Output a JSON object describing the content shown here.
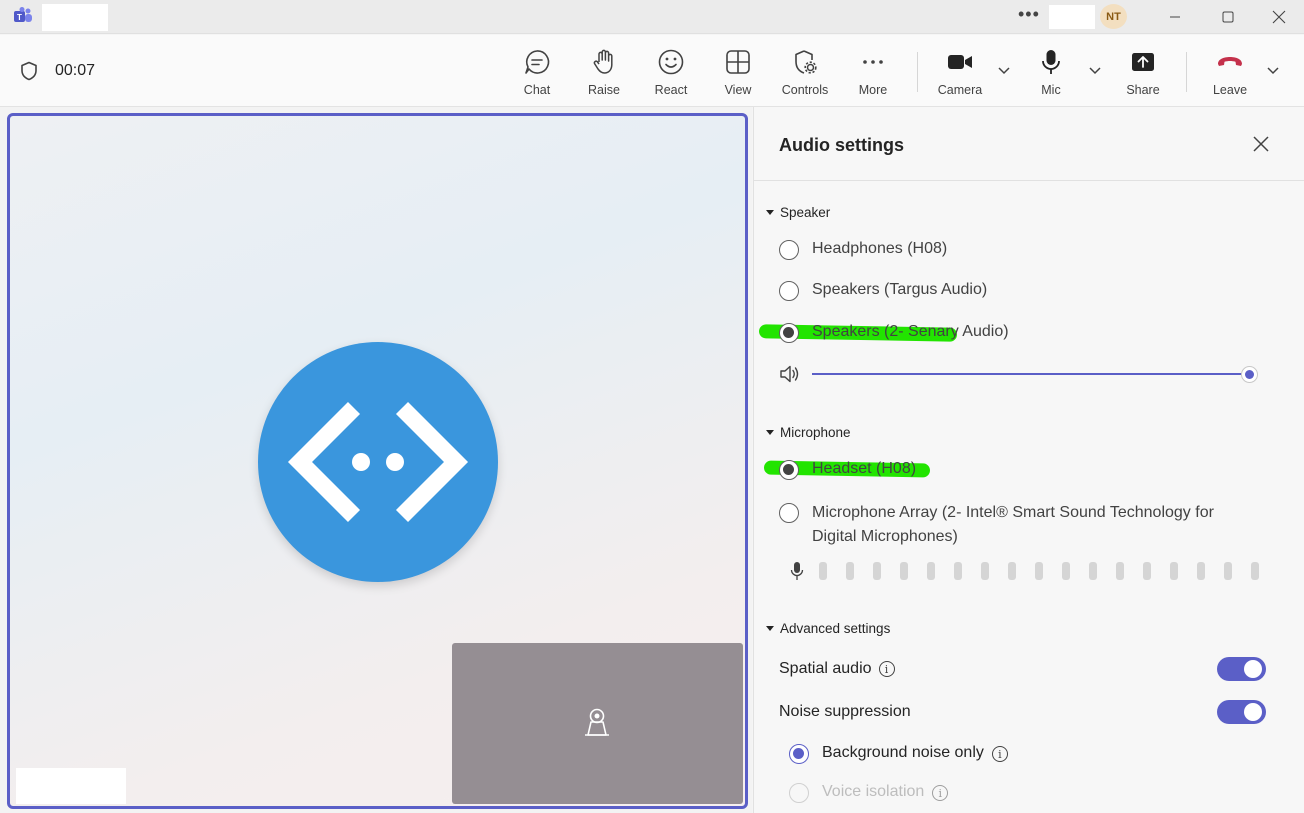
{
  "header": {
    "avatar_initials": "NT",
    "more_options": "•••"
  },
  "toolbar": {
    "timer": "00:07",
    "buttons": {
      "chat": "Chat",
      "raise": "Raise",
      "react": "React",
      "view": "View",
      "controls": "Controls",
      "more": "More",
      "camera": "Camera",
      "mic": "Mic",
      "share": "Share",
      "leave": "Leave"
    },
    "leave_color": "#c4314b"
  },
  "panel": {
    "title": "Audio settings",
    "speaker": {
      "heading": "Speaker",
      "options": [
        "Headphones (H08)",
        "Speakers (Targus Audio)",
        "Speakers (2- Senary Audio)"
      ],
      "selected": "Speakers (2- Senary Audio)",
      "volume": 1.0
    },
    "microphone": {
      "heading": "Microphone",
      "options": [
        "Headset (H08)",
        "Microphone Array (2- Intel® Smart Sound Technology for Digital Microphones)"
      ],
      "option2_line1": "Microphone Array (2- Intel® Smart Sound Technology for",
      "option2_line2": "Digital Microphones)",
      "selected": "Headset (H08)"
    },
    "advanced": {
      "heading": "Advanced settings",
      "spatial_audio": "Spatial audio",
      "spatial_audio_on": true,
      "noise_suppression": "Noise suppression",
      "noise_suppression_on": true,
      "noise_options": [
        "Background noise only",
        "Voice isolation"
      ],
      "noise_selected": "Background noise only"
    }
  },
  "colors": {
    "accent": "#5b5fc7",
    "bot_avatar": "#3a96dd",
    "highlight": "#22e400"
  }
}
